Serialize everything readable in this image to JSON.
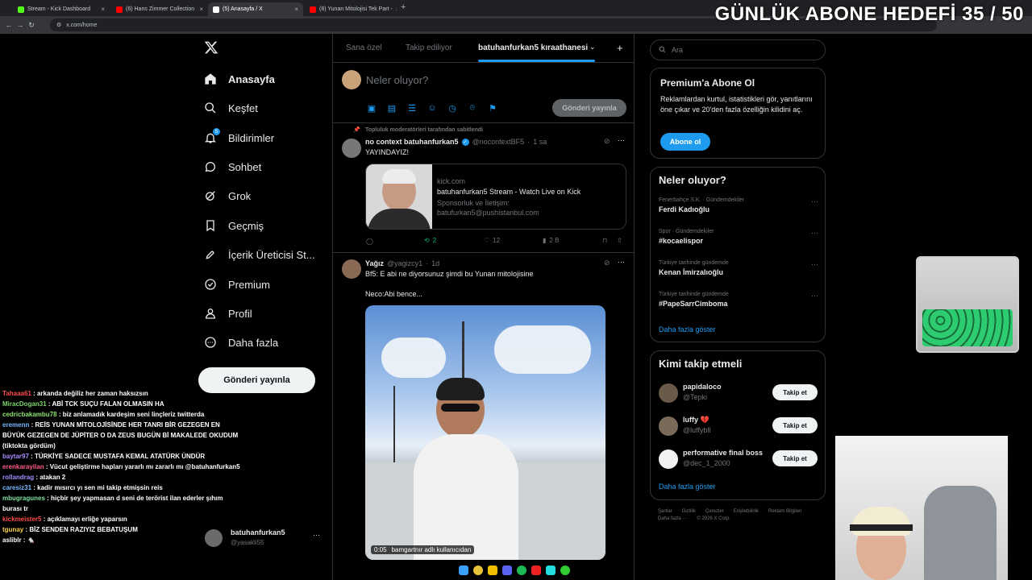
{
  "browser": {
    "tabs": [
      {
        "label": "Stream - Kick Dashboard",
        "color": "#53fc18"
      },
      {
        "label": "(6) Hans Zimmer Collection",
        "color": "#ff0000"
      },
      {
        "label": "(5) Anasayfa / X",
        "color": "#ffffff"
      },
      {
        "label": "(8) Yunan Mitolojisi Tek Part -",
        "color": "#ff0000"
      }
    ],
    "new_tab": "+",
    "url": "x.com/home"
  },
  "overlay": {
    "goal_text": "GÜNLÜK ABONE HEDEFİ 35 / 50"
  },
  "nav": {
    "logo": "X",
    "items": [
      {
        "label": "Anasayfa",
        "icon": "home-icon"
      },
      {
        "label": "Keşfet",
        "icon": "search-icon"
      },
      {
        "label": "Bildirimler",
        "icon": "bell-icon"
      },
      {
        "label": "Sohbet",
        "icon": "chat-icon"
      },
      {
        "label": "Grok",
        "icon": "grok-icon"
      },
      {
        "label": "Geçmiş",
        "icon": "bookmark-icon"
      },
      {
        "label": "İçerik Üreticisi St...",
        "icon": "rocket-icon"
      },
      {
        "label": "Premium",
        "icon": "premium-icon"
      },
      {
        "label": "Profil",
        "icon": "profile-icon"
      },
      {
        "label": "Daha fazla",
        "icon": "more-circle-icon"
      }
    ],
    "post_button": "Gönderi yayınla",
    "account": {
      "name": "batuhanfurkan5",
      "handle": "@yasakli55"
    },
    "notification_badge": "5"
  },
  "chat": [
    {
      "user": "Tahaaa61",
      "color": "#ff4d4d",
      "text": "arkanda değiliz her zaman haksızsın"
    },
    {
      "user": "MiracDogan31",
      "color": "#7cd36b",
      "text": "ABİ TCK SUÇU FALAN OLMASIN HA"
    },
    {
      "user": "cedricbakambu78",
      "color": "#8be36f",
      "text": "biz anlamadık kardeşim seni linçleriz twitterda"
    },
    {
      "user": "eremenn",
      "color": "#79b8ff",
      "text": "REİS YUNAN MİTOLOJİSİNDE HER TANRI BİR GEZEGEN EN BÜYÜK GEZEGEN DE JÜPİTER O DA ZEUS BUGÜN Bİ MAKALEDE OKUDUM (tiktokta gördüm)"
    },
    {
      "user": "baytar97",
      "color": "#a98bff",
      "text": "TÜRKİYE SADECE MUSTAFA KEMAL ATATÜRK ÜNDÜR"
    },
    {
      "user": "erenkarayilan",
      "color": "#ff5c8a",
      "text": "Vücut geliştirme hapları yararlı mı zararlı mı @batuhanfurkan5"
    },
    {
      "user": "rollandrag",
      "color": "#a68bff",
      "text": "atakan 2"
    },
    {
      "user": "caresiz31",
      "color": "#79b8ff",
      "text": "kadir mısırcı yı sen mi takip etmişsin reis"
    },
    {
      "user": "mbugragunes",
      "color": "#7ee0a0",
      "text": "hiçbir şey yapmasan d seni de terörist ilan ederler şıhım burası tr"
    },
    {
      "user": "kickmeister5",
      "color": "#ff4d4d",
      "text": "açıklamayı erliğe yaparsın"
    },
    {
      "user": "tgunay",
      "color": "#ffd24d",
      "text": "BİZ SENDEN RAZIYIZ BEBATUŞUM"
    },
    {
      "user": "asliblr",
      "color": "#ffffff",
      "text": "🐁"
    }
  ],
  "timeline": {
    "tabs": [
      "Sana özel",
      "Takip ediliyor",
      "batuhanfurkan5 kıraathanesi"
    ],
    "add_tab": "+",
    "compose_placeholder": "Neler oluyor?",
    "compose_post": "Gönderi yayınla",
    "pinned_label": "Topluluk moderatörleri tarafından sabitlendi",
    "tweet1": {
      "name": "no context batuhanfurkan5",
      "handle": "@nocontextBF5",
      "time": "1 sa",
      "text": "YAYINDAYIZ!",
      "card_domain": "kick.com",
      "card_title": "batuhanfurkan5 Stream - Watch Live on Kick",
      "card_desc": "Sponsorluk ve İletişim: batufurkan5@pushistanbul.com",
      "retweets": "2",
      "likes": "12",
      "views": "2 B"
    },
    "tweet2": {
      "name": "Yağız",
      "handle": "@yagizcy1",
      "time": "1d",
      "text1": "Bf5: E abi ne diyorsunuz şimdi bu Yunan mitolojisine",
      "text2": "Neco:Abi bence...",
      "video_time": "0:05",
      "video_caption": "bamgartnır adlı kullanıcıdan"
    }
  },
  "right": {
    "search_placeholder": "Ara",
    "premium": {
      "title": "Premium'a Abone Ol",
      "desc": "Reklamlardan kurtul, istatistikleri gör, yanıtlarını öne çıkar ve 20'den fazla özelliğin kilidini aç.",
      "button": "Abone ol"
    },
    "trends_title": "Neler oluyor?",
    "trends": [
      {
        "meta": "Fenerbahçe S.K. · Gündemdekiler",
        "name": "Ferdi Kadıoğlu"
      },
      {
        "meta": "Spor · Gündemdekiler",
        "name": "#kocaelispor"
      },
      {
        "meta": "Türkiye tarihinde gündemde",
        "name": "Kenan İmirzalıoğlu"
      },
      {
        "meta": "Türkiye tarihinde gündemde",
        "name": "#PapeSarrCimboma"
      }
    ],
    "trends_more": "Daha fazla göster",
    "who_title": "Kimi takip etmeli",
    "who": [
      {
        "name": "papidaloco",
        "handle": "@Tepki",
        "button": "Takip et"
      },
      {
        "name": "luffy 💔",
        "handle": "@luffybll",
        "button": "Takip et"
      },
      {
        "name": "performative final boss",
        "handle": "@dec_1_2000",
        "button": "Takip et"
      }
    ],
    "who_more": "Daha fazla göster",
    "footer": [
      "Şartlar",
      "Gizlilik",
      "Çerezler",
      "Erişilebilirlik",
      "Reklam Bilgileri",
      "Daha fazla ···",
      "© 2026 X Corp."
    ]
  }
}
